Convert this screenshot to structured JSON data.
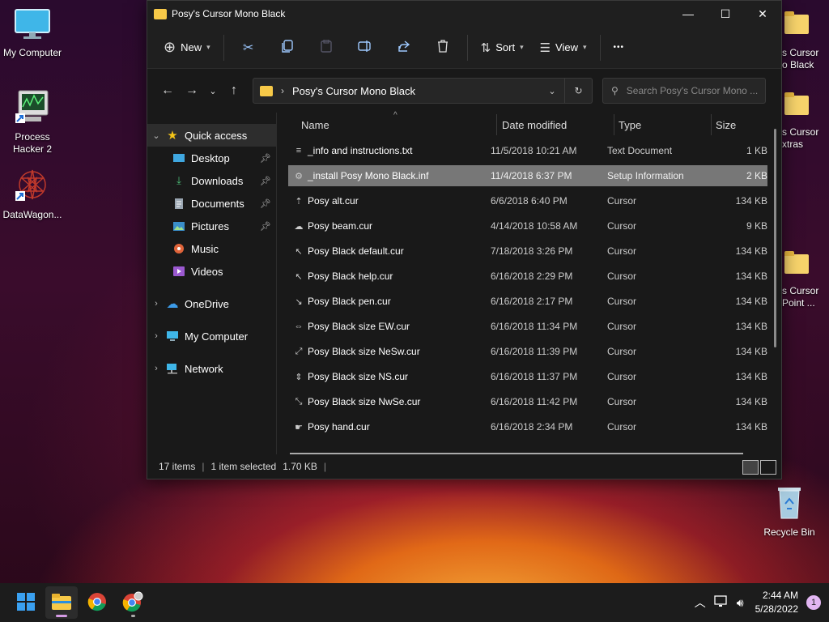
{
  "desktop": {
    "icons_left": [
      {
        "label": "My Computer",
        "icon": "monitor-icon"
      },
      {
        "label": "Process Hacker 2",
        "icon": "process-hacker-icon"
      },
      {
        "label": "DataWagon...",
        "icon": "datawagon-icon"
      }
    ],
    "icons_right": [
      {
        "label": "s Cursor\no Black",
        "icon": "folder-icon"
      },
      {
        "label": "s Cursor\nxtras",
        "icon": "folder-icon"
      },
      {
        "label": "s Cursor\nPoint ...",
        "icon": "folder-icon"
      }
    ],
    "recycle_bin": "Recycle Bin"
  },
  "window": {
    "title": "Posy's Cursor Mono Black",
    "controls": {
      "minimize": "—",
      "maximize": "☐",
      "close": "✕"
    }
  },
  "toolbar": {
    "new_label": "New",
    "sort_label": "Sort",
    "view_label": "View",
    "more_label": "•••"
  },
  "address": {
    "path": "Posy's Cursor Mono Black",
    "search_placeholder": "Search Posy's Cursor Mono ..."
  },
  "nav": {
    "quick_access": "Quick access",
    "items": [
      {
        "label": "Desktop",
        "pinned": true
      },
      {
        "label": "Downloads",
        "pinned": true
      },
      {
        "label": "Documents",
        "pinned": true
      },
      {
        "label": "Pictures",
        "pinned": true
      },
      {
        "label": "Music",
        "pinned": false
      },
      {
        "label": "Videos",
        "pinned": false
      }
    ],
    "onedrive": "OneDrive",
    "my_computer": "My Computer",
    "network": "Network"
  },
  "columns": {
    "name": "Name",
    "date": "Date modified",
    "type": "Type",
    "size": "Size"
  },
  "files": [
    {
      "name": "_info and instructions.txt",
      "date": "11/5/2018 10:21 AM",
      "type": "Text Document",
      "size": "1 KB",
      "icon": "≡"
    },
    {
      "name": "_install Posy Mono Black.inf",
      "date": "11/4/2018 6:37 PM",
      "type": "Setup Information",
      "size": "2 KB",
      "icon": "⚙"
    },
    {
      "name": "Posy alt.cur",
      "date": "6/6/2018 6:40 PM",
      "type": "Cursor",
      "size": "134 KB",
      "icon": "⇡"
    },
    {
      "name": "Posy beam.cur",
      "date": "4/14/2018 10:58 AM",
      "type": "Cursor",
      "size": "9 KB",
      "icon": "☁"
    },
    {
      "name": "Posy Black default.cur",
      "date": "7/18/2018 3:26 PM",
      "type": "Cursor",
      "size": "134 KB",
      "icon": "↖"
    },
    {
      "name": "Posy Black help.cur",
      "date": "6/16/2018 2:29 PM",
      "type": "Cursor",
      "size": "134 KB",
      "icon": "↖"
    },
    {
      "name": "Posy Black pen.cur",
      "date": "6/16/2018 2:17 PM",
      "type": "Cursor",
      "size": "134 KB",
      "icon": "↘"
    },
    {
      "name": "Posy Black size EW.cur",
      "date": "6/16/2018 11:34 PM",
      "type": "Cursor",
      "size": "134 KB",
      "icon": "⇔"
    },
    {
      "name": "Posy Black size NeSw.cur",
      "date": "6/16/2018 11:39 PM",
      "type": "Cursor",
      "size": "134 KB",
      "icon": "⤢"
    },
    {
      "name": "Posy Black size NS.cur",
      "date": "6/16/2018 11:37 PM",
      "type": "Cursor",
      "size": "134 KB",
      "icon": "⇕"
    },
    {
      "name": "Posy Black size NwSe.cur",
      "date": "6/16/2018 11:42 PM",
      "type": "Cursor",
      "size": "134 KB",
      "icon": "⤡"
    },
    {
      "name": "Posy hand.cur",
      "date": "6/16/2018 2:34 PM",
      "type": "Cursor",
      "size": "134 KB",
      "icon": "☛"
    }
  ],
  "selected_index": 1,
  "status": {
    "count": "17 items",
    "selection": "1 item selected",
    "size": "1.70 KB"
  },
  "taskbar": {
    "time": "2:44 AM",
    "date": "5/28/2022",
    "notifications": "1"
  }
}
